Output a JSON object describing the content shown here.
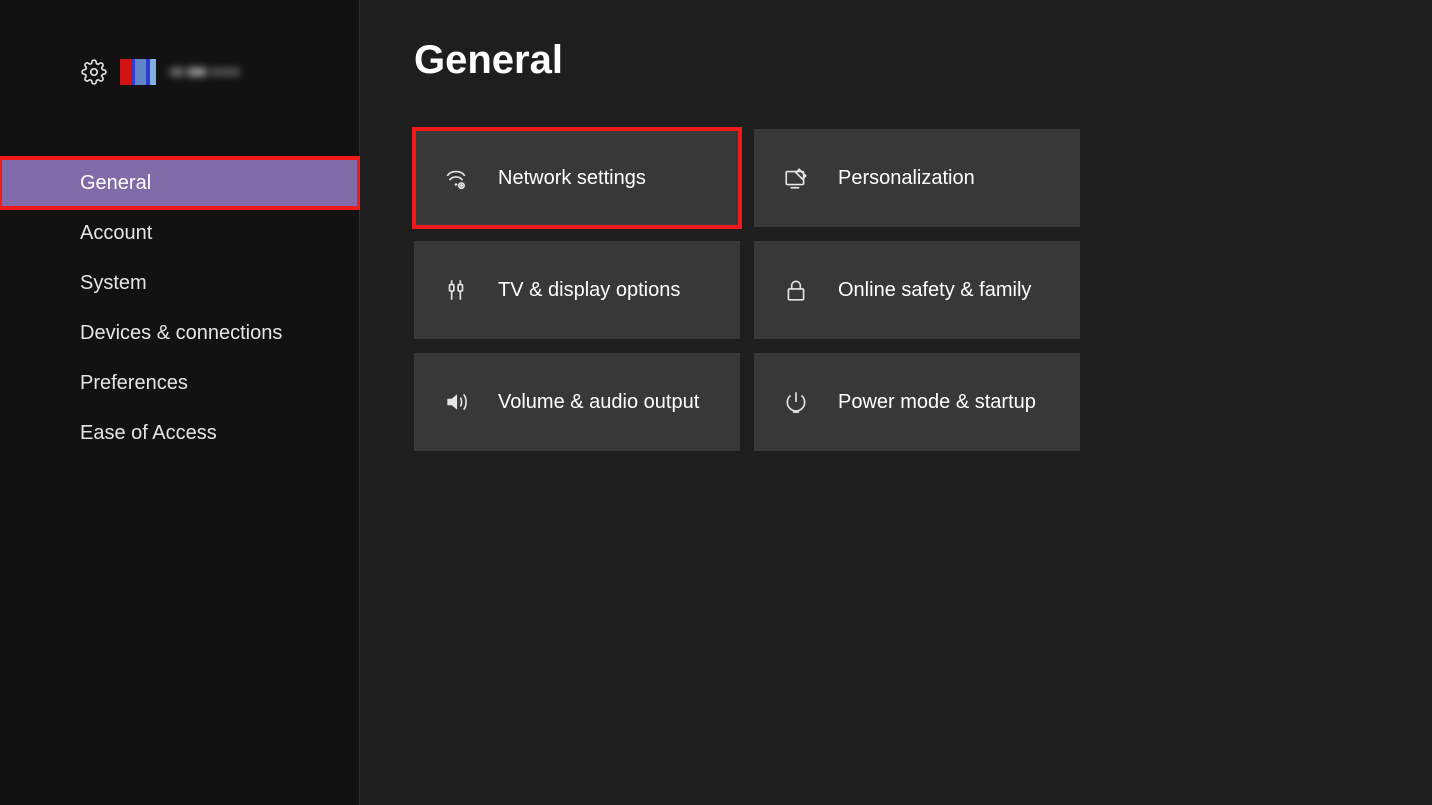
{
  "page": {
    "title": "General"
  },
  "sidebar": {
    "items": [
      {
        "id": "general",
        "label": "General",
        "selected": true,
        "highlighted": true
      },
      {
        "id": "account",
        "label": "Account",
        "selected": false,
        "highlighted": false
      },
      {
        "id": "system",
        "label": "System",
        "selected": false,
        "highlighted": false
      },
      {
        "id": "devices",
        "label": "Devices & connections",
        "selected": false,
        "highlighted": false
      },
      {
        "id": "preferences",
        "label": "Preferences",
        "selected": false,
        "highlighted": false
      },
      {
        "id": "ease",
        "label": "Ease of Access",
        "selected": false,
        "highlighted": false
      }
    ]
  },
  "tiles": [
    {
      "id": "network",
      "label": "Network settings",
      "icon": "network-icon",
      "highlighted": true
    },
    {
      "id": "personal",
      "label": "Personalization",
      "icon": "personal-icon",
      "highlighted": false
    },
    {
      "id": "display",
      "label": "TV & display options",
      "icon": "display-icon",
      "highlighted": false
    },
    {
      "id": "safety",
      "label": "Online safety & family",
      "icon": "lock-icon",
      "highlighted": false
    },
    {
      "id": "audio",
      "label": "Volume & audio output",
      "icon": "audio-icon",
      "highlighted": false
    },
    {
      "id": "power",
      "label": "Power mode & startup",
      "icon": "power-icon",
      "highlighted": false
    }
  ],
  "colors": {
    "accent": "#806aa8",
    "highlight": "#f01a1a"
  }
}
